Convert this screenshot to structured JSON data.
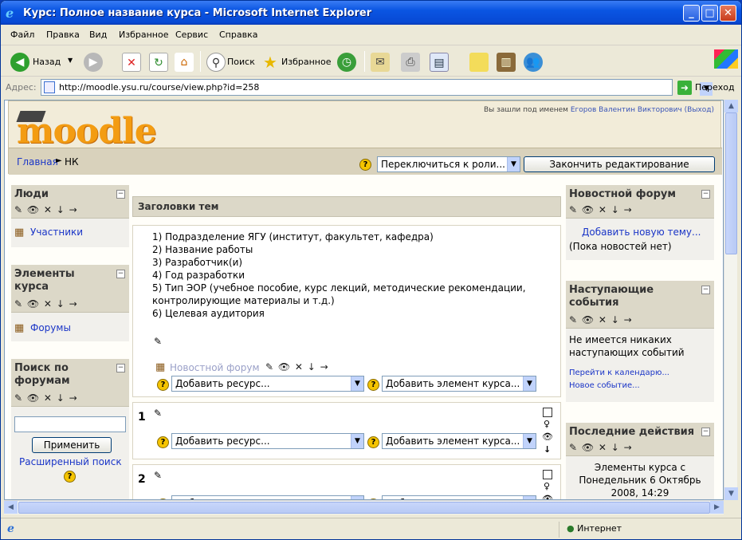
{
  "window": {
    "title": "Курс: Полное название курса - Microsoft Internet Explorer"
  },
  "menu": [
    "Файл",
    "Правка",
    "Вид",
    "Избранное",
    "Сервис",
    "Справка"
  ],
  "toolbar": {
    "back": "Назад",
    "search": "Поиск",
    "favorites": "Избранное"
  },
  "address": {
    "label": "Адрес:",
    "url": "http://moodle.ysu.ru/course/view.php?id=258",
    "go": "Переход"
  },
  "header": {
    "logo": "moodle",
    "login_prefix": "Вы зашли под именем",
    "user_name": "Егоров Валентин Викторович",
    "logout": "(Выход)"
  },
  "nav": {
    "home": "Главная",
    "separator": "►",
    "current": "НК"
  },
  "role_switch": "Переключиться к роли...",
  "finish_edit": "Закончить редактирование",
  "left": {
    "people": {
      "title": "Люди",
      "participants": "Участники"
    },
    "elements": {
      "title": "Элементы курса",
      "forums": "Форумы"
    },
    "search": {
      "title": "Поиск по форумам",
      "apply": "Применить",
      "advanced": "Расширенный поиск"
    }
  },
  "center": {
    "topics_header": "Заголовки тем",
    "topic0_lines": [
      "1) Подразделение ЯГУ (институт, факультет, кафедра)",
      "2) Название работы",
      "3) Разработчик(и)",
      "4) Год разработки",
      "5) Тип ЭОР (учебное пособие, курс лекций, методические рекомендации,",
      "контролирующие материалы и т.д.)",
      "6) Целевая аудитория"
    ],
    "news_forum": "Новостной форум",
    "add_resource": "Добавить ресурс...",
    "add_activity": "Добавить элемент курса...",
    "section1_num": "1",
    "section2_num": "2"
  },
  "right": {
    "news": {
      "title": "Новостной форум",
      "add_topic": "Добавить новую тему...",
      "empty": "(Пока новостей нет)"
    },
    "events": {
      "title": "Наступающие события",
      "none": "Не имеется никаких наступающих событий",
      "calendar": "Перейти к календарю...",
      "new_event": "Новое событие..."
    },
    "recent": {
      "title": "Последние действия",
      "since": "Элементы курса с Понедельник 6 Октябрь 2008, 14:29"
    }
  },
  "status": {
    "zone": "Интернет"
  },
  "icons": {
    "edit_tools": "✎ 👁 ✕ ↓ →",
    "help": "?"
  }
}
